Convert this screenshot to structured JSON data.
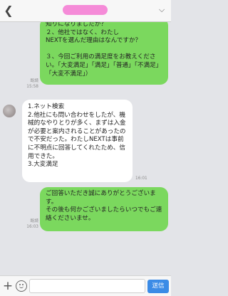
{
  "header": {
    "back_icon": "chevron-left-icon",
    "title": "",
    "title_color": "#f58bd8",
    "menu_icon": "chevron-down-icon"
  },
  "messages": [
    {
      "direction": "out",
      "text": "知りになりましたか？\n２、他社ではなく、わたし\nNEXTを選んだ理由はなんですか？\n\n３、今回ご利用の満足度をお教えください。「大変満足」「満足」「普通」「不満足」「大変不満足」）",
      "read": "既読",
      "time": "15:58"
    },
    {
      "direction": "in",
      "text": "1.ネット検索\n2.他社にも問い合わせをしたが、機械的なやりとりが多く、まずは入金が必要と案内されることがあったので不安だった。わたしNEXTは事前に不明点に回答してくれたため、信用できた。\n3.大変満足",
      "time": "16:01"
    },
    {
      "direction": "out",
      "text": "ご回答いただき誠にありがとうございます。\nその後も何かございましたらいつでもご連絡くださいませ。",
      "read": "既読",
      "time": "16:03"
    }
  ],
  "input_bar": {
    "plus_icon": "plus-icon",
    "emoji_icon": "smiley-icon",
    "placeholder": "",
    "send_label": "送信",
    "send_color": "#3b8be6"
  },
  "colors": {
    "background": "#e3e4e8",
    "outgoing_bubble": "#7bd85e",
    "incoming_bubble": "#ffffff"
  }
}
